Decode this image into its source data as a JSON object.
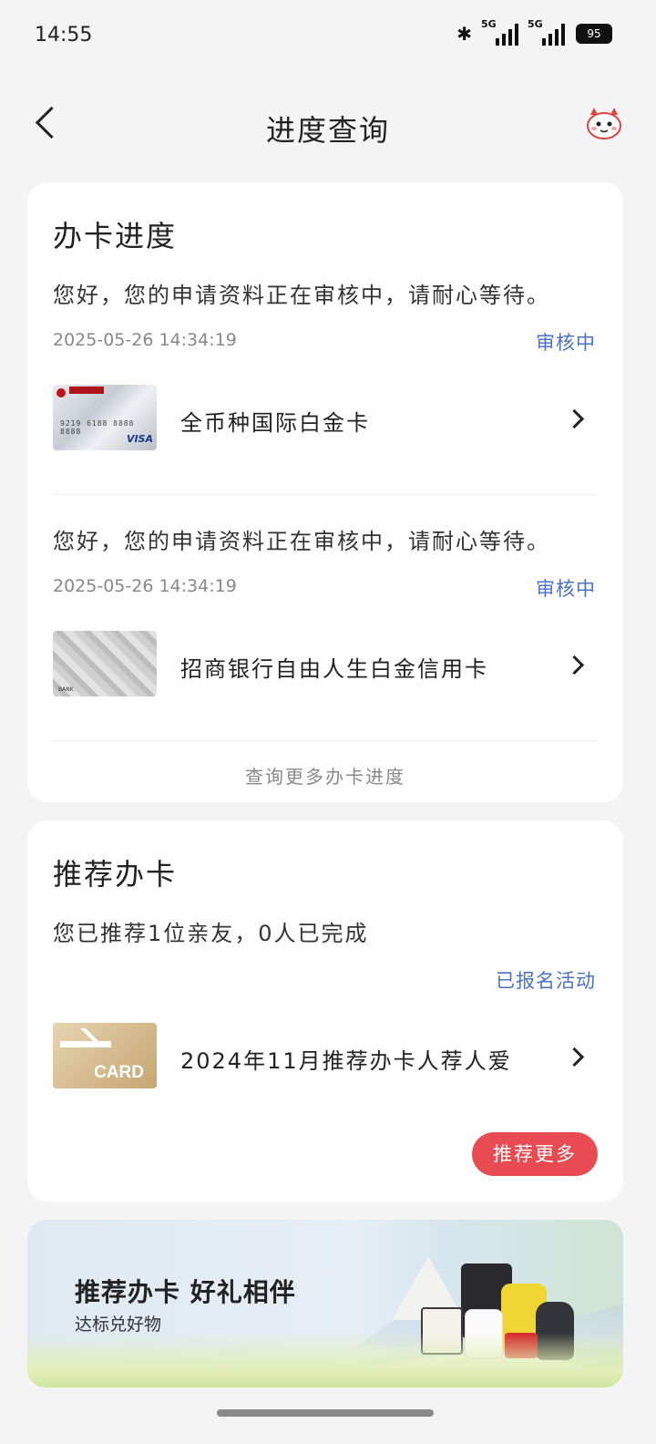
{
  "status_bar": {
    "time": "14:55",
    "network_1": "5G",
    "network_2": "5G",
    "battery": "95"
  },
  "nav": {
    "title": "进度查询"
  },
  "progress": {
    "title": "办卡进度",
    "items": [
      {
        "message": "您好，您的申请资料正在审核中，请耐心等待。",
        "date": "2025-05-26 14:34:19",
        "status": "审核中",
        "card_name": "全币种国际白金卡"
      },
      {
        "message": "您好，您的申请资料正在审核中，请耐心等待。",
        "date": "2025-05-26 14:34:19",
        "status": "审核中",
        "card_name": "招商银行自由人生白金信用卡"
      }
    ],
    "more_label": "查询更多办卡进度"
  },
  "recommend": {
    "title": "推荐办卡",
    "summary": "您已推荐1位亲友，0人已完成",
    "activity_status": "已报名活动",
    "activity_name": "2024年11月推荐办卡人荐人爱",
    "card_word": "CARD",
    "more_button": "推荐更多"
  },
  "banner": {
    "title": "推荐办卡 好礼相伴",
    "subtitle": "达标兑好物"
  },
  "colors": {
    "accent_blue": "#4a72c0",
    "button_red": "#e94b52",
    "background": "#f4f4f4"
  }
}
